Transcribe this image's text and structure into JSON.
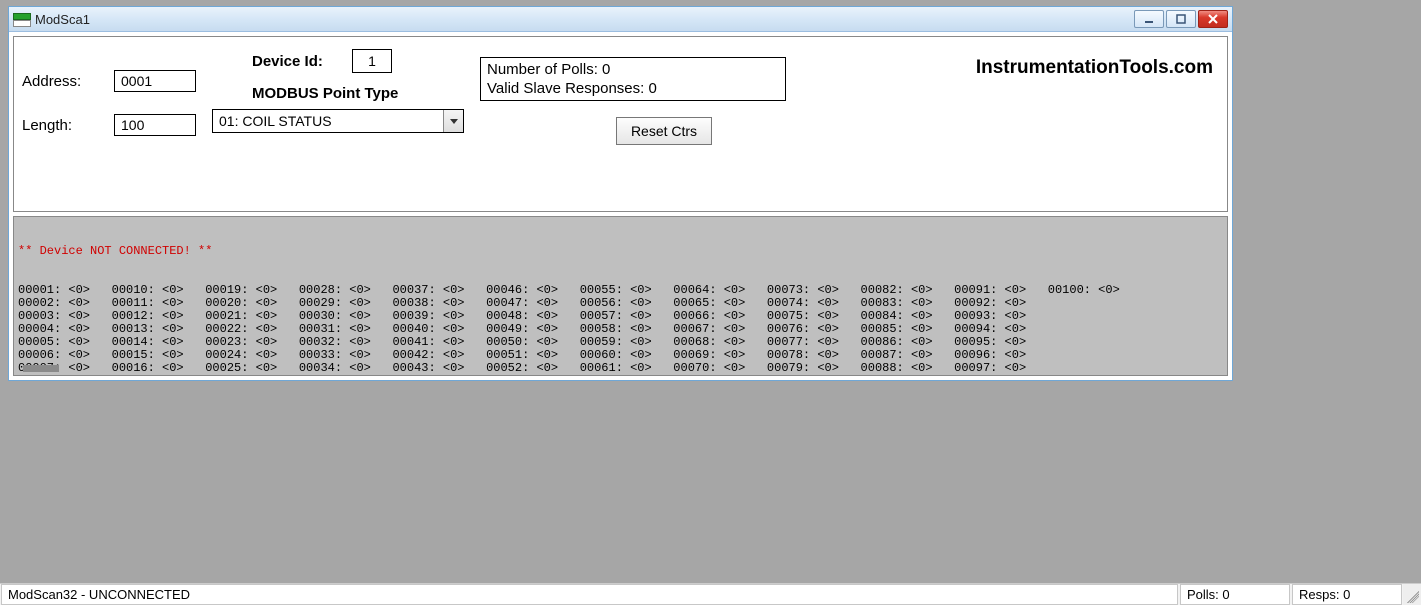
{
  "window": {
    "title": "ModSca1"
  },
  "config": {
    "address_label": "Address:",
    "address_value": "0001",
    "length_label": "Length:",
    "length_value": "100",
    "device_id_label": "Device Id:",
    "device_id_value": "1",
    "point_type_label": "MODBUS Point Type",
    "point_type_value": "01: COIL STATUS"
  },
  "stats": {
    "polls_label": "Number of Polls:",
    "polls_value": "0",
    "responses_label": "Valid Slave Responses:",
    "responses_value": "0",
    "reset_label": "Reset Ctrs"
  },
  "brand": "InstrumentationTools.com",
  "data": {
    "warning": "** Device NOT CONNECTED! **",
    "count": 100,
    "default_value": "<0>"
  },
  "status": {
    "main": "ModScan32 - UNCONNECTED",
    "polls": "Polls: 0",
    "resps": "Resps: 0"
  }
}
